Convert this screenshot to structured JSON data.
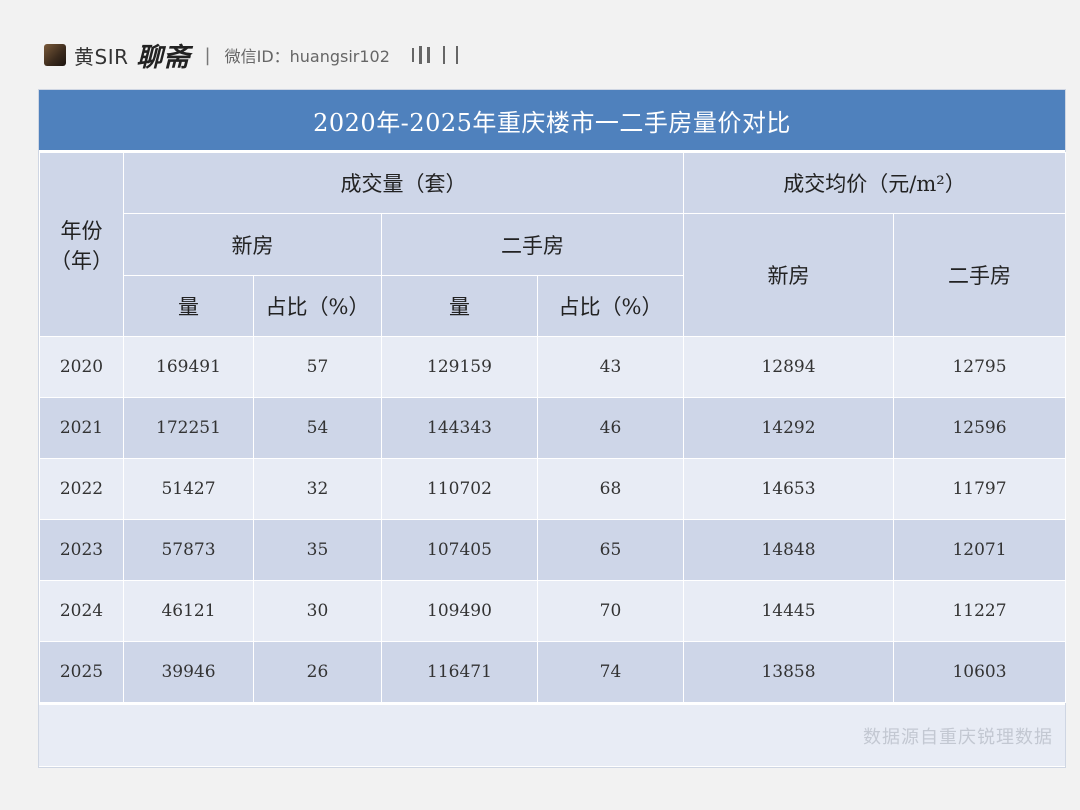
{
  "header": {
    "brand": "黄SIR",
    "brand_script": "聊斋",
    "separator": "|",
    "wechat": "微信ID：huangsir102"
  },
  "table": {
    "title": "2020年-2025年重庆楼市一二手房量价对比",
    "year_header": "年份\n（年）",
    "volume_header": "成交量（套）",
    "price_header": "成交均价（元/m²）",
    "new_label": "新房",
    "second_label": "二手房",
    "qty_label": "量",
    "share_label": "占比（%）",
    "rows": [
      {
        "year": "2020",
        "new_qty": "169491",
        "new_share": "57",
        "second_qty": "129159",
        "second_share": "43",
        "new_price": "12894",
        "second_price": "12795"
      },
      {
        "year": "2021",
        "new_qty": "172251",
        "new_share": "54",
        "second_qty": "144343",
        "second_share": "46",
        "new_price": "14292",
        "second_price": "12596"
      },
      {
        "year": "2022",
        "new_qty": "51427",
        "new_share": "32",
        "second_qty": "110702",
        "second_share": "68",
        "new_price": "14653",
        "second_price": "11797"
      },
      {
        "year": "2023",
        "new_qty": "57873",
        "new_share": "35",
        "second_qty": "107405",
        "second_share": "65",
        "new_price": "14848",
        "second_price": "12071"
      },
      {
        "year": "2024",
        "new_qty": "46121",
        "new_share": "30",
        "second_qty": "109490",
        "second_share": "70",
        "new_price": "14445",
        "second_price": "11227"
      },
      {
        "year": "2025",
        "new_qty": "39946",
        "new_share": "26",
        "second_qty": "116471",
        "second_share": "74",
        "new_price": "13858",
        "second_price": "10603"
      }
    ]
  },
  "footer": {
    "source": "数据源自重庆锐理数据"
  },
  "colors": {
    "title_bg": "#4f81bd",
    "header_bg": "#ced6e8",
    "row_light": "#e8ecf5"
  }
}
